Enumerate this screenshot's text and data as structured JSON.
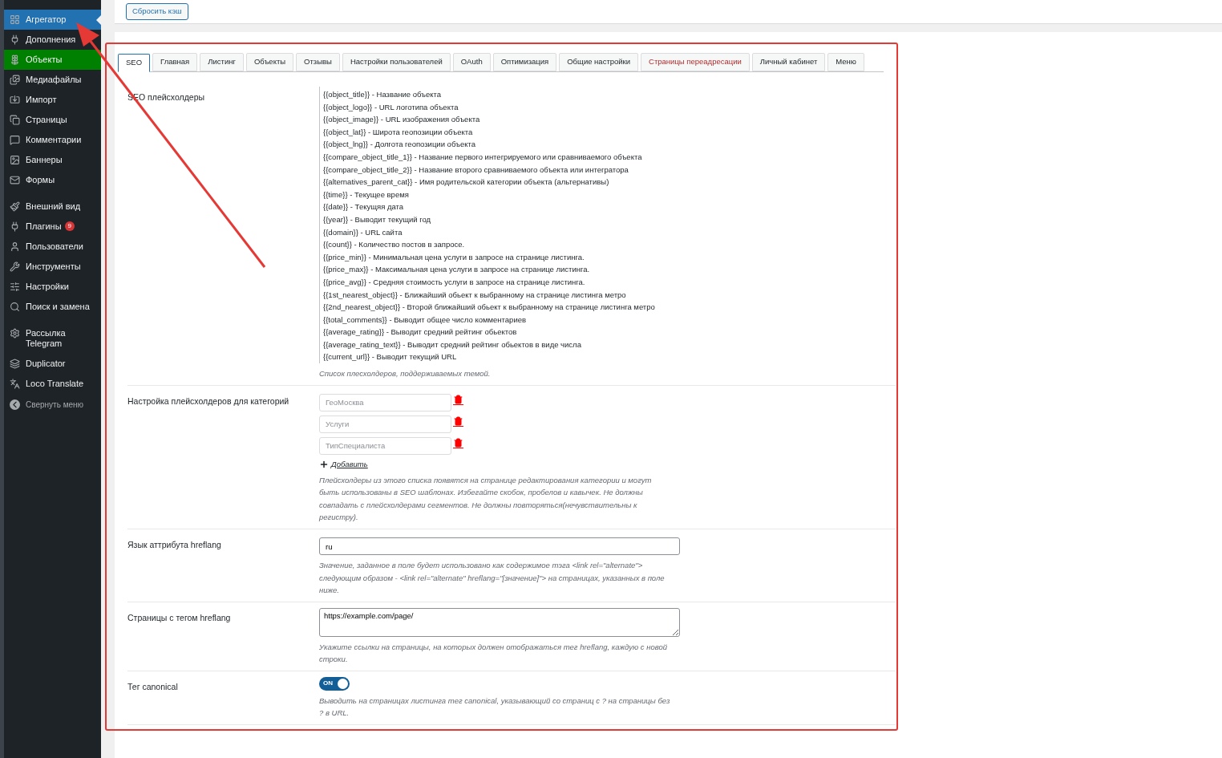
{
  "sidebar": {
    "groups": [
      {
        "items": [
          {
            "label": "Агрегатор",
            "selected": true,
            "highlighted": false
          },
          {
            "label": "Дополнения",
            "selected": false,
            "highlighted": false
          },
          {
            "label": "Объекты",
            "selected": false,
            "highlighted": true
          },
          {
            "label": "Медиафайлы",
            "selected": false,
            "highlighted": false
          },
          {
            "label": "Импорт",
            "selected": false,
            "highlighted": false
          },
          {
            "label": "Страницы",
            "selected": false,
            "highlighted": false
          },
          {
            "label": "Комментарии",
            "selected": false,
            "highlighted": false
          },
          {
            "label": "Баннеры",
            "selected": false,
            "highlighted": false
          },
          {
            "label": "Формы",
            "selected": false,
            "highlighted": false
          }
        ]
      },
      {
        "items": [
          {
            "label": "Внешний вид",
            "selected": false,
            "highlighted": false
          },
          {
            "label": "Плагины",
            "badge": "9",
            "selected": false,
            "highlighted": false
          },
          {
            "label": "Пользователи",
            "selected": false,
            "highlighted": false
          },
          {
            "label": "Инструменты",
            "selected": false,
            "highlighted": false
          },
          {
            "label": "Настройки",
            "selected": false,
            "highlighted": false
          },
          {
            "label": "Поиск и замена",
            "selected": false,
            "highlighted": false
          }
        ]
      },
      {
        "items": [
          {
            "label": "Рассылка Telegram",
            "selected": false,
            "highlighted": false
          },
          {
            "label": "Duplicator",
            "selected": false,
            "highlighted": false
          },
          {
            "label": "Loco Translate",
            "selected": false,
            "highlighted": false
          }
        ]
      }
    ],
    "collapse": "Свернуть меню"
  },
  "top_bar": {
    "button": "Сбросить кэш"
  },
  "annotation": {
    "frame": true,
    "arrow": true
  },
  "tabs": [
    {
      "label": "SEO",
      "selected": true,
      "hovered": false
    },
    {
      "label": "Главная",
      "selected": false,
      "hovered": false
    },
    {
      "label": "Листинг",
      "selected": false,
      "hovered": false
    },
    {
      "label": "Объекты",
      "selected": false,
      "hovered": false
    },
    {
      "label": "Отзывы",
      "selected": false,
      "hovered": false
    },
    {
      "label": "Настройки пользователей",
      "selected": false,
      "hovered": false
    },
    {
      "label": "OAuth",
      "selected": false,
      "hovered": false
    },
    {
      "label": "Оптимизация",
      "selected": false,
      "hovered": false
    },
    {
      "label": "Общие настройки",
      "selected": false,
      "hovered": false
    },
    {
      "label": "Страницы переадресации",
      "selected": false,
      "hovered": true
    },
    {
      "label": "Личный кабинет",
      "selected": false,
      "hovered": false
    },
    {
      "label": "Меню",
      "selected": false,
      "hovered": false
    }
  ],
  "settings": [
    {
      "kind": "list",
      "label": "SEO плейсхолдеры",
      "items": [
        "{{object_title}} - Название объекта",
        "{{object_logo}} - URL логотипа объекта",
        "{{object_image}} - URL изображения объекта",
        "{{object_lat}} - Широта геопозиции объекта",
        "{{object_lng}} - Долгота геопозиции объекта",
        "{{compare_object_title_1}} - Название первого интегрируемого или сравниваемого объекта",
        "{{compare_object_title_2}} - Название второго сравниваемого объекта или интегратора",
        "{{alternatives_parent_cat}} - Имя родительской категории объекта (альтернативы)",
        "{{time}} - Текущее время",
        "{{date}} - Текущяя дата",
        "{{year}} - Выводит текущий год",
        "{{domain}} - URL сайта",
        "{{count}} - Количество постов в запросе.",
        "{{price_min}} - Минимальная цена услуги в запросе на странице листинга.",
        "{{price_max}} - Максимальная цена услуги в запросе на странице листинга.",
        "{{price_avg}} - Средняя стоимость услуги в запросе на странице листинга.",
        "{{1st_nearest_object}} - Ближайший обьект к выбранному на странице листинга метро",
        "{{2nd_nearest_object}} - Второй ближайший обьект к выбранному на странице листинга метро",
        "{{total_comments}} - Выводит общее число комментариев",
        "{{average_rating}} - Выводит средний рейтинг обьектов",
        "{{average_rating_text}} - Выводит средний рейтинг обьектов в виде числа",
        "{{current_url}} - Выводит текущий URL"
      ],
      "description": "Список плесхолдеров, поддерживаемых темой."
    },
    {
      "kind": "repeater",
      "label": "Настройка плейсхолдеров для категорий",
      "fields": [
        {
          "placeholder": "ГеоМосква"
        },
        {
          "placeholder": "Услуги"
        },
        {
          "placeholder": "ТипСпециалиста"
        }
      ],
      "add": "Добавить",
      "description": "Плейсхолдеры из этого списка появятся на странице редактирования категории и могут быть использованы в SEO шаблонах. Избегайте скобок, пробелов и кавычек. Не должны совпадать с плейсхолдерами сегментов. Не должны повторяться(нечувствительны к регистру)."
    },
    {
      "kind": "text",
      "label": "Язык аттрибута hreflang",
      "value": "ru",
      "description": "Значение, заданное в поле будет использовано как содержимое тэга <link rel=\"alternate\"> следующим образом - <link rel=\"alternate\" hreflang=\"[значение]\"> на страницах, указанных в поле ниже."
    },
    {
      "kind": "textarea",
      "label": "Страницы с тегом hreflang",
      "value": "https://example.com/page/",
      "description": "Укажите ссылки на страницы, на которых должен отображаться тег hreflang, каждую с новой строки."
    },
    {
      "kind": "toggle",
      "label": "Тег canonical",
      "on": true,
      "toggle_text": "ON",
      "description": "Выводить на страницах листинга тег canonical, указывающий со страниц с ? на страницы без ? в URL."
    }
  ]
}
